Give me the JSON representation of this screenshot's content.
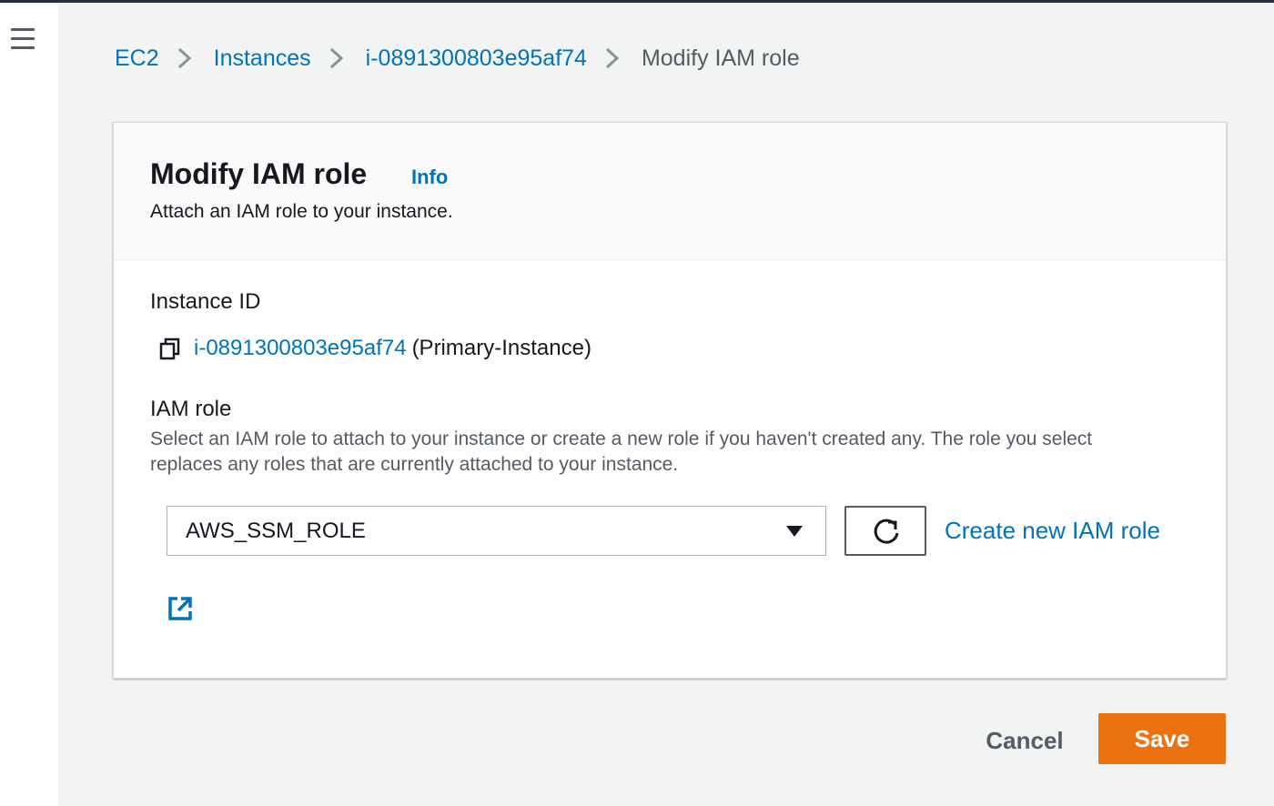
{
  "breadcrumb": {
    "items": [
      "EC2",
      "Instances",
      "i-0891300803e95af74"
    ],
    "current": "Modify IAM role"
  },
  "panel": {
    "title": "Modify IAM role",
    "info_label": "Info",
    "description": "Attach an IAM role to your instance."
  },
  "instance": {
    "label": "Instance ID",
    "id": "i-0891300803e95af74",
    "name": "(Primary-Instance)"
  },
  "iam_role": {
    "label": "IAM role",
    "description": "Select an IAM role to attach to your instance or create a new role if you haven't created any. The role you select replaces any roles that are currently attached to your instance.",
    "selected": "AWS_SSM_ROLE",
    "create_label": "Create new IAM role"
  },
  "footer": {
    "cancel_label": "Cancel",
    "save_label": "Save"
  },
  "icons": {
    "menu": "hamburger-menu-icon",
    "separator": "chevron-right-icon",
    "copy": "copy-icon",
    "caret": "caret-down-icon",
    "refresh": "refresh-icon",
    "external": "external-link-icon"
  },
  "colors": {
    "link": "#0073bb",
    "primary": "#ec7211",
    "text": "#16191f",
    "secondary_text": "#545b64",
    "background": "#f2f3f3"
  }
}
